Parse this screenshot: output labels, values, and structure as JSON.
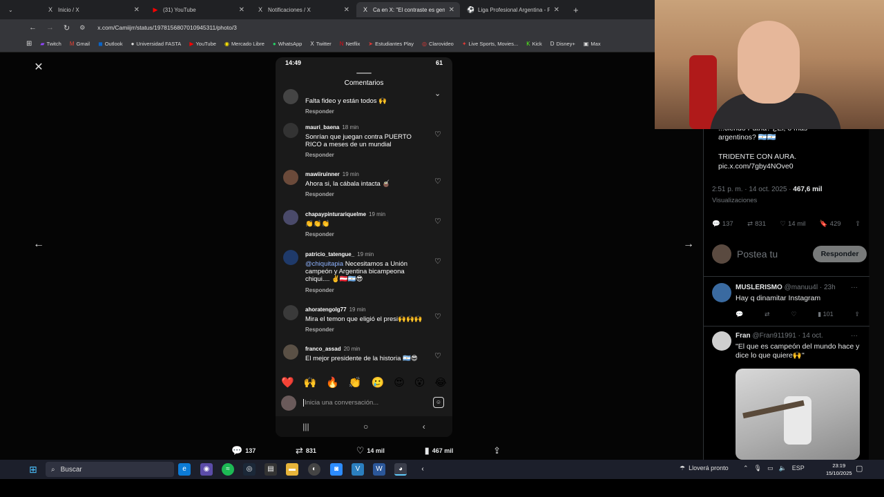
{
  "browser": {
    "tabs": [
      {
        "favicon": "X",
        "title": "Inicio / X",
        "active": false
      },
      {
        "favicon": "▶",
        "title": "(31) YouTube",
        "active": false
      },
      {
        "favicon": "X",
        "title": "Notificaciones / X",
        "active": false
      },
      {
        "favicon": "X",
        "title": "Ca en X: \"El contraste es genial",
        "active": true
      },
      {
        "favicon": "⚽",
        "title": "Liga Profesional Argentina - PO",
        "active": false
      }
    ],
    "new_tab": "+",
    "url": "x.com/Camiijrr/status/1978156807010945311/photo/3",
    "bookmarks": [
      "Twitch",
      "Gmail",
      "Outlook",
      "Universidad FASTA",
      "YouTube",
      "Mercado Libre",
      "WhatsApp",
      "Twitter",
      "Netflix",
      "Estudiantes Play",
      "Clarovideo",
      "Live Sports, Movies...",
      "Kick",
      "Disney+",
      "Max"
    ]
  },
  "phone": {
    "time": "14:49",
    "battery": "61",
    "sheet_title": "Comentarios",
    "comments": [
      {
        "user": "",
        "time": "",
        "text": "Falta fideo y están todos 🙌",
        "reply": "Responder"
      },
      {
        "user": "mauri_baena",
        "time": "18 min",
        "text": "Sonrían que juegan contra PUERTO RICO  a meses de un mundial",
        "reply": "Responder"
      },
      {
        "user": "mawiiruinner",
        "time": "19 min",
        "text": "Ahora si, la cábala intacta 🧉",
        "reply": "Responder"
      },
      {
        "user": "chapaypinturariquelme",
        "time": "19 min",
        "text": "👏👏👏",
        "reply": "Responder"
      },
      {
        "user": "patricio_tatengue_",
        "time": "19 min",
        "mention": "@chiquitapia",
        "text": " Necesitamos a Unión campeón y Argentina bicampeona chiqui.... ✌️🇦🇹🇦🇷😎",
        "reply": "Responder"
      },
      {
        "user": "ahoratengolg77",
        "time": "19 min",
        "text": "Mira el temon que eligió el presi🙌🙌🙌",
        "reply": "Responder"
      },
      {
        "user": "franco_assad",
        "time": "20 min",
        "text": "El mejor presidente de la historia 🇦🇷😎",
        "reply": ""
      }
    ],
    "reactions": [
      "❤️",
      "🙌",
      "🔥",
      "👏",
      "🥲",
      "😍",
      "😮",
      "😂"
    ],
    "composer_placeholder": "Inicia una conversación..."
  },
  "post_stats": {
    "replies": "137",
    "reposts": "831",
    "likes": "14 mil",
    "views": "467 mil"
  },
  "right_panel": {
    "quote_lines": [
      "...ciendo Patria? ¿Ei, o más",
      "argentinos? 🇦🇷🇦🇷",
      "",
      "TRIDENTE CON AURA.",
      "pic.x.com/7gby4NOve0"
    ],
    "timestamp": "2:51 p. m. · 14 oct. 2025 · ",
    "views_count": "467,6 mil",
    "views_label": "Visualizaciones",
    "stats": {
      "replies": "137",
      "reposts": "831",
      "likes": "14 mil",
      "bookmarks": "429"
    },
    "reply_placeholder": "Postea tu",
    "reply_button": "Responder",
    "replies": [
      {
        "name": "MUSLERISMO",
        "handle": "@manuu4l · 23h",
        "text": "Hay q dinamitar Instagram",
        "views": "101"
      },
      {
        "name": "Fran",
        "handle": "@Fran911991 · 14 oct.",
        "text": "\"El que es campeón del mundo hace y dice lo que quiere🙌\""
      }
    ]
  },
  "taskbar": {
    "search_placeholder": "Buscar",
    "weather": "Lloverá pronto",
    "language": "ESP",
    "time": "23:19",
    "date": "15/10/2025"
  },
  "colors": {
    "page_bg": "#000000",
    "accent": "#1d9bf0",
    "mention": "#8fb3ff",
    "reply_button": "#787a7a"
  }
}
